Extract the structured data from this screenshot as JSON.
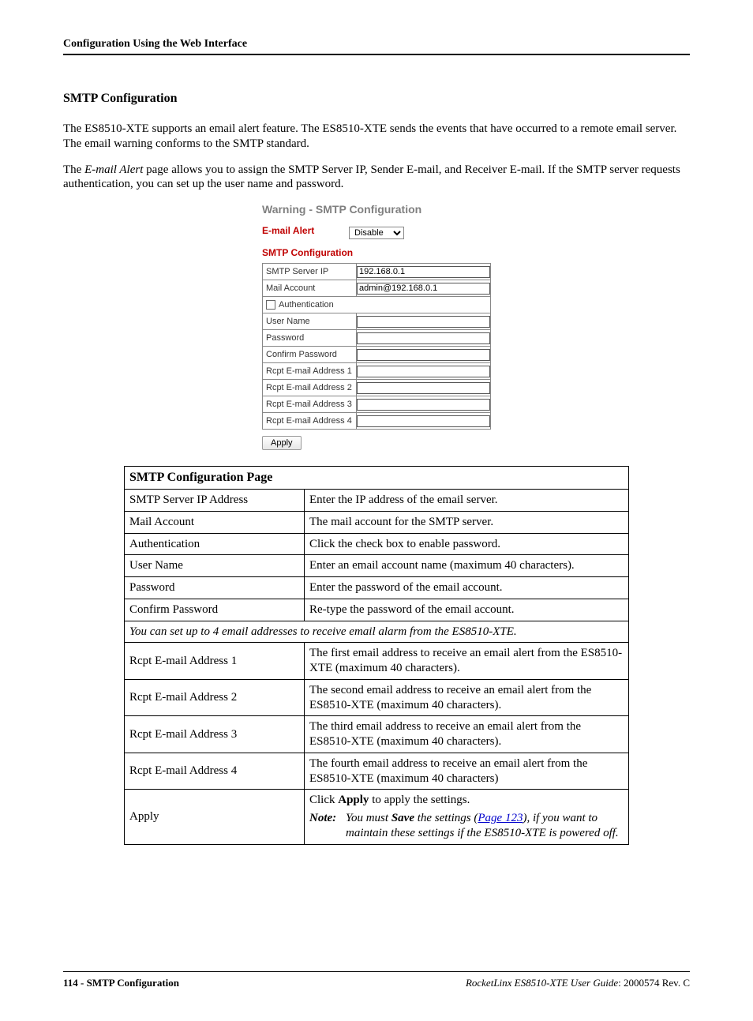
{
  "header": {
    "running": "Configuration Using the Web Interface"
  },
  "section": {
    "title": "SMTP Configuration",
    "para1": "The ES8510-XTE supports an email alert feature. The ES8510-XTE sends the events that have occurred to a remote email server. The email warning conforms to the SMTP standard.",
    "para2_pre": "The ",
    "para2_em": "E-mail Alert",
    "para2_post": " page allows you to assign the SMTP Server IP, Sender E-mail, and Receiver E-mail. If the SMTP server requests authentication, you can set up the user name and password."
  },
  "shot": {
    "page_title": "Warning - SMTP Configuration",
    "email_alert_label": "E-mail Alert",
    "email_alert_value": "Disable",
    "smtp_conf_label": "SMTP Configuration",
    "rows": {
      "smtp_server_ip": {
        "label": "SMTP Server IP",
        "value": "192.168.0.1"
      },
      "mail_account": {
        "label": "Mail Account",
        "value": "admin@192.168.0.1"
      },
      "authentication": {
        "label": "Authentication"
      },
      "user_name": {
        "label": "User Name",
        "value": ""
      },
      "password": {
        "label": "Password",
        "value": ""
      },
      "confirm_pw": {
        "label": "Confirm Password",
        "value": ""
      },
      "rcpt1": {
        "label": "Rcpt E-mail Address 1",
        "value": ""
      },
      "rcpt2": {
        "label": "Rcpt E-mail Address 2",
        "value": ""
      },
      "rcpt3": {
        "label": "Rcpt E-mail Address 3",
        "value": ""
      },
      "rcpt4": {
        "label": "Rcpt E-mail Address 4",
        "value": ""
      }
    },
    "apply_label": "Apply"
  },
  "desc_table": {
    "title": "SMTP Configuration Page",
    "rows": [
      {
        "field": "SMTP Server IP Address",
        "text": "Enter the IP address of the email server."
      },
      {
        "field": "Mail Account",
        "text": "The mail account for the SMTP server."
      },
      {
        "field": "Authentication",
        "text": "Click the check box to enable password."
      },
      {
        "field": "User Name",
        "text": "Enter an email account name (maximum 40 characters)."
      },
      {
        "field": "Password",
        "text": "Enter the password of the email account."
      },
      {
        "field": "Confirm Password",
        "text": "Re-type the password of the email account."
      }
    ],
    "span_note": "You can set up to 4 email addresses to receive email alarm from the ES8510-XTE.",
    "rcpt_rows": [
      {
        "field": "Rcpt E-mail Address 1",
        "text": "The first email address to receive an email alert from the ES8510-XTE (maximum 40 characters)."
      },
      {
        "field": "Rcpt E-mail Address 2",
        "text": "The second email address to receive an email alert from the ES8510-XTE (maximum 40 characters)."
      },
      {
        "field": "Rcpt E-mail Address 3",
        "text": "The third email address to receive an email alert from the ES8510-XTE (maximum 40 characters)."
      },
      {
        "field": "Rcpt E-mail Address 4",
        "text": "The fourth email address to receive an email alert from the ES8510-XTE (maximum 40 characters)"
      }
    ],
    "apply_row": {
      "field": "Apply",
      "line1_pre": "Click ",
      "line1_bold": "Apply",
      "line1_post": " to apply the settings.",
      "note_label": "Note:",
      "note_pre": " You must ",
      "note_bold": "Save",
      "note_mid": " the settings (",
      "note_link": "Page 123",
      "note_post": "), if you want to maintain these settings if the ES8510-XTE is powered off."
    }
  },
  "footer": {
    "left": "114 - SMTP Configuration",
    "right_em": "RocketLinx ES8510-XTE User Guide",
    "right_post": ": 2000574 Rev. C"
  }
}
